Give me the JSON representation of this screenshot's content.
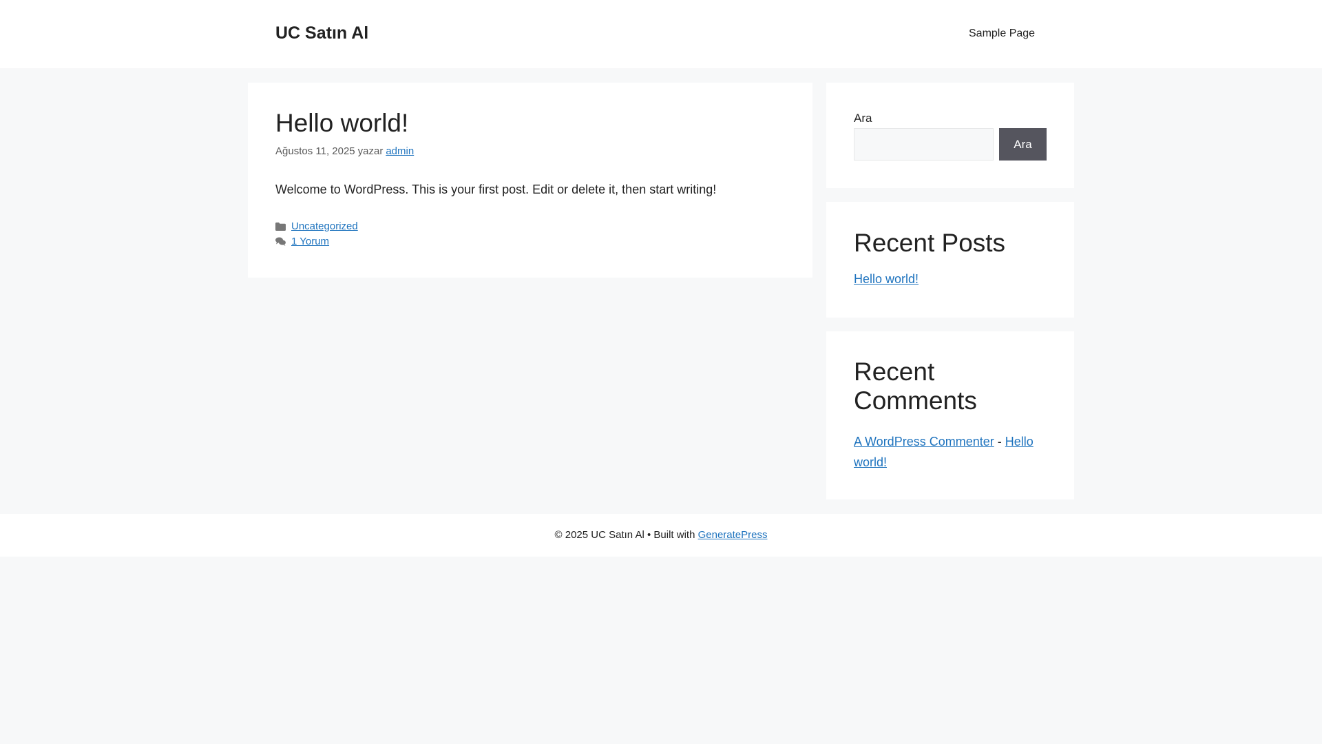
{
  "header": {
    "site_title": "UC Satın Al",
    "nav": [
      {
        "label": "Sample Page"
      }
    ]
  },
  "article": {
    "title": "Hello world!",
    "date": "Ağustos 11, 2025",
    "author_prefix": "yazar",
    "author": "admin",
    "content": "Welcome to WordPress. This is your first post. Edit or delete it, then start writing!",
    "category": "Uncategorized",
    "comments_link": "1 Yorum",
    "category_icon": "folder-icon",
    "comments_icon": "comments-icon"
  },
  "sidebar": {
    "search": {
      "label": "Ara",
      "input_value": "",
      "button": "Ara"
    },
    "recent_posts": {
      "title": "Recent Posts",
      "items": [
        "Hello world!"
      ]
    },
    "recent_comments": {
      "title": "Recent Comments",
      "author": "A WordPress Commenter",
      "separator": "-",
      "post": "Hello world!"
    }
  },
  "footer": {
    "copyright": "© 2025 UC Satın Al • Built with",
    "link": "GeneratePress"
  },
  "colors": {
    "background": "#f7f8f9",
    "link": "#1e73be",
    "button": "#55555e",
    "text": "#222222"
  }
}
